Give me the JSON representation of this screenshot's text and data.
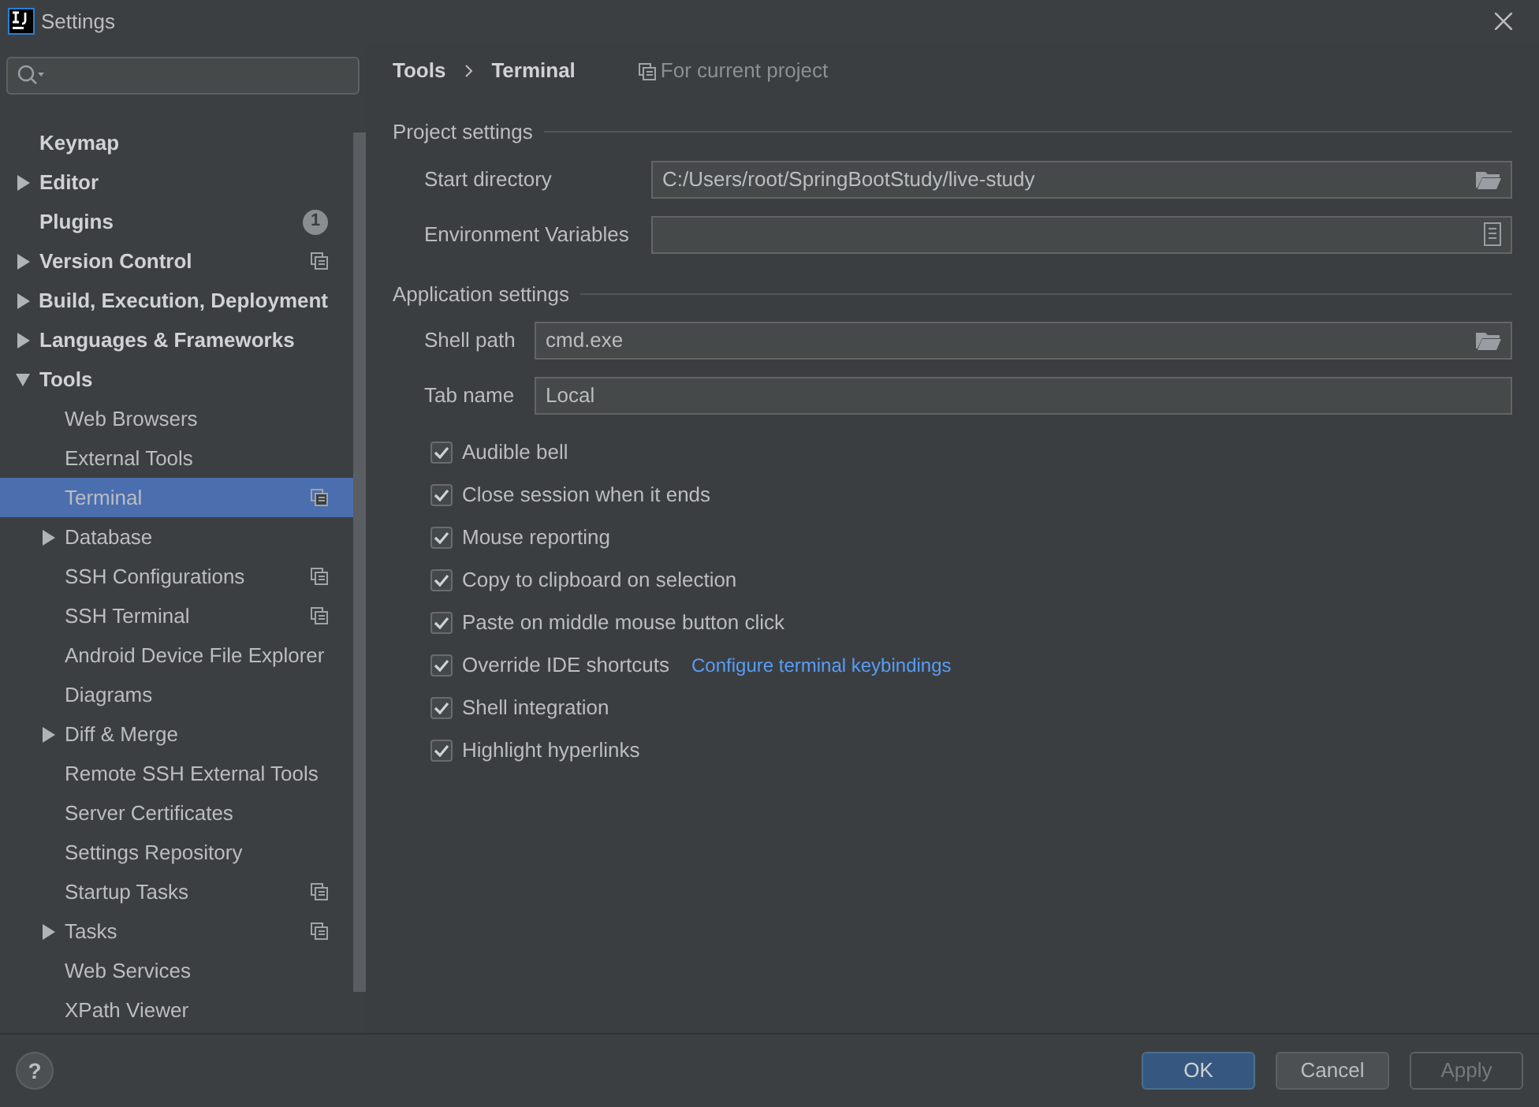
{
  "window": {
    "title": "Settings"
  },
  "sidebar": {
    "items": [
      {
        "label": "Keymap",
        "selected": false,
        "project_scope": false
      },
      {
        "label": "Editor",
        "selected": false,
        "expanded": false,
        "project_scope": false
      },
      {
        "label": "Plugins",
        "selected": false,
        "project_scope": false,
        "badge": "1"
      },
      {
        "label": "Version Control",
        "selected": false,
        "expanded": false,
        "project_scope": true
      },
      {
        "label": "Build, Execution, Deployment",
        "selected": false,
        "expanded": false,
        "project_scope": false
      },
      {
        "label": "Languages & Frameworks",
        "selected": false,
        "expanded": false,
        "project_scope": false
      },
      {
        "label": "Tools",
        "selected": false,
        "expanded": true,
        "project_scope": false,
        "children": [
          {
            "label": "Web Browsers",
            "selected": false,
            "project_scope": false
          },
          {
            "label": "External Tools",
            "selected": false,
            "project_scope": false
          },
          {
            "label": "Terminal",
            "selected": true,
            "project_scope": true
          },
          {
            "label": "Database",
            "selected": false,
            "expanded": false,
            "project_scope": false
          },
          {
            "label": "SSH Configurations",
            "selected": false,
            "project_scope": true
          },
          {
            "label": "SSH Terminal",
            "selected": false,
            "project_scope": true
          },
          {
            "label": "Android Device File Explorer",
            "selected": false,
            "project_scope": false
          },
          {
            "label": "Diagrams",
            "selected": false,
            "project_scope": false
          },
          {
            "label": "Diff & Merge",
            "selected": false,
            "expanded": false,
            "project_scope": false
          },
          {
            "label": "Remote SSH External Tools",
            "selected": false,
            "project_scope": false
          },
          {
            "label": "Server Certificates",
            "selected": false,
            "project_scope": false
          },
          {
            "label": "Settings Repository",
            "selected": false,
            "project_scope": false
          },
          {
            "label": "Startup Tasks",
            "selected": false,
            "project_scope": true
          },
          {
            "label": "Tasks",
            "selected": false,
            "expanded": false,
            "project_scope": true
          },
          {
            "label": "Web Services",
            "selected": false,
            "project_scope": false
          },
          {
            "label": "XPath Viewer",
            "selected": false,
            "project_scope": false
          }
        ]
      }
    ]
  },
  "breadcrumb": [
    "Tools",
    "Terminal"
  ],
  "scope_note": "For current project",
  "sections": [
    {
      "title": "Project settings",
      "fields": [
        {
          "label": "Start directory",
          "value": "C:/Users/root/SpringBootStudy/live-study",
          "kind": "folder"
        },
        {
          "label": "Environment Variables",
          "kind": "list"
        }
      ]
    },
    {
      "title": "Application settings",
      "fields": [
        {
          "label": "Shell path",
          "value": "cmd.exe",
          "kind": "folder"
        },
        {
          "label": "Tab name",
          "value": "Local",
          "kind": "text"
        }
      ]
    }
  ],
  "options": [
    {
      "label": "Audible bell",
      "checked": true
    },
    {
      "label": "Close session when it ends",
      "checked": true
    },
    {
      "label": "Mouse reporting",
      "checked": true
    },
    {
      "label": "Copy to clipboard on selection",
      "checked": true
    },
    {
      "label": "Paste on middle mouse button click",
      "checked": true
    },
    {
      "label": "Override IDE shortcuts",
      "checked": true,
      "link": "Configure terminal keybindings"
    },
    {
      "label": "Shell integration",
      "checked": true
    },
    {
      "label": "Highlight hyperlinks",
      "checked": true
    }
  ],
  "help": "?",
  "buttons": [
    {
      "label": "OK",
      "kind": "primary"
    },
    {
      "label": "Cancel",
      "kind": "normal"
    },
    {
      "label": "Apply",
      "kind": "disabled"
    }
  ]
}
